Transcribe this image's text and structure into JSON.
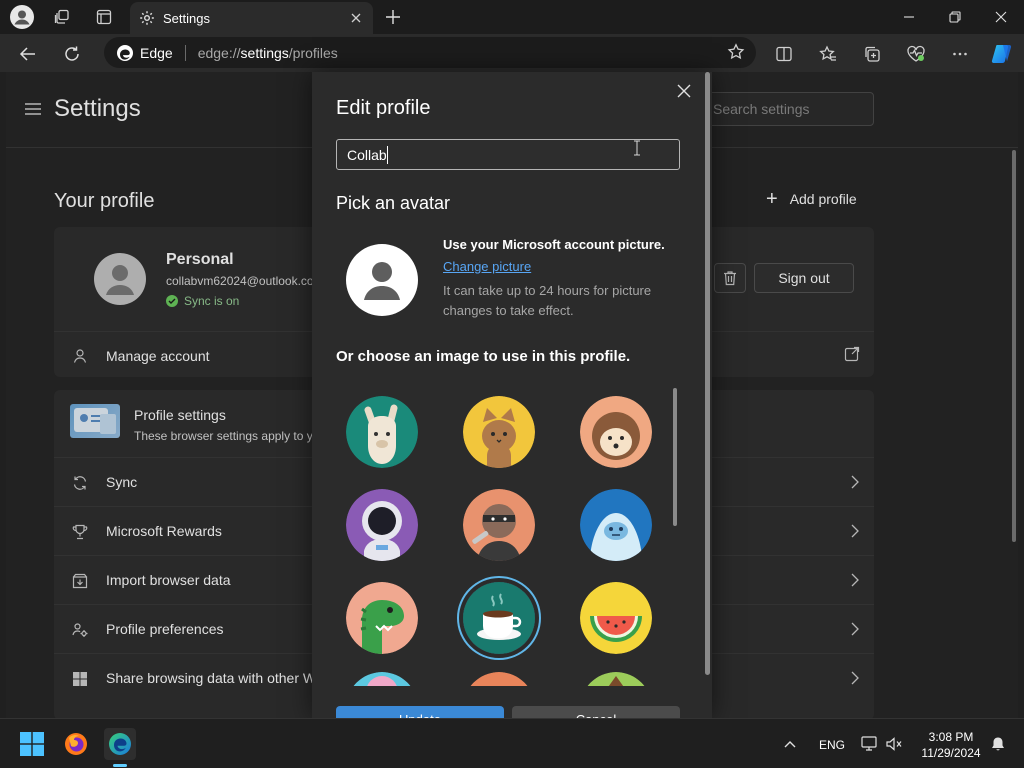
{
  "browser": {
    "tab_title": "Settings",
    "brand": "Edge",
    "url_scheme": "edge://",
    "url_host": "settings",
    "url_path": "/profiles"
  },
  "settings_page": {
    "title": "Settings",
    "search_placeholder": "Search settings",
    "your_profile_heading": "Your profile",
    "add_profile_label": "Add profile",
    "profile": {
      "name": "Personal",
      "email": "collabvm62024@outlook.co",
      "sync_status": "Sync is on",
      "sign_out_label": "Sign out",
      "manage_account_label": "Manage account"
    },
    "profile_settings": {
      "title": "Profile settings",
      "description": "These browser settings apply to y"
    },
    "rows": [
      {
        "label": "Sync",
        "icon": "sync-icon"
      },
      {
        "label": "Microsoft Rewards",
        "icon": "trophy-icon"
      },
      {
        "label": "Import browser data",
        "icon": "import-icon"
      },
      {
        "label": "Profile preferences",
        "icon": "people-settings-icon"
      },
      {
        "label": "Share browsing data with other W",
        "icon": "windows-icon"
      }
    ]
  },
  "dialog": {
    "title": "Edit profile",
    "name_value": "Collab",
    "pick_avatar_heading": "Pick an avatar",
    "ms_picture_title": "Use your Microsoft account picture.",
    "change_picture_link": "Change picture",
    "ms_picture_note": "It can take up to 24 hours for picture changes to take effect.",
    "choose_image_heading": "Or choose an image to use in this profile.",
    "avatars": [
      {
        "name": "llama-avatar",
        "bg": "#1a8a7a"
      },
      {
        "name": "cat-avatar",
        "bg": "#f2c63c"
      },
      {
        "name": "hedgehog-avatar",
        "bg": "#f0a882"
      },
      {
        "name": "astronaut-avatar",
        "bg": "#8a5bb5"
      },
      {
        "name": "ninja-avatar",
        "bg": "#e8926e"
      },
      {
        "name": "yeti-avatar",
        "bg": "#2176c0"
      },
      {
        "name": "dinosaur-avatar",
        "bg": "#f0a890"
      },
      {
        "name": "coffee-avatar",
        "bg": "#197a6e",
        "selected": true
      },
      {
        "name": "watermelon-avatar",
        "bg": "#f5d63a"
      },
      {
        "name": "partial-avatar-1",
        "bg": "#5cc8e0"
      },
      {
        "name": "partial-avatar-2",
        "bg": "#e8845a"
      },
      {
        "name": "partial-avatar-3",
        "bg": "#9ccc5a"
      }
    ],
    "primary_button_label": "Update",
    "cancel_button_label": "Cancel"
  },
  "taskbar": {
    "language": "ENG",
    "time": "3:08 PM",
    "date": "11/29/2024"
  },
  "colors": {
    "accent": "#3b89d6",
    "link": "#58a6f5",
    "selected_ring": "#60b6e8",
    "sync_green": "#6ccb5f"
  }
}
